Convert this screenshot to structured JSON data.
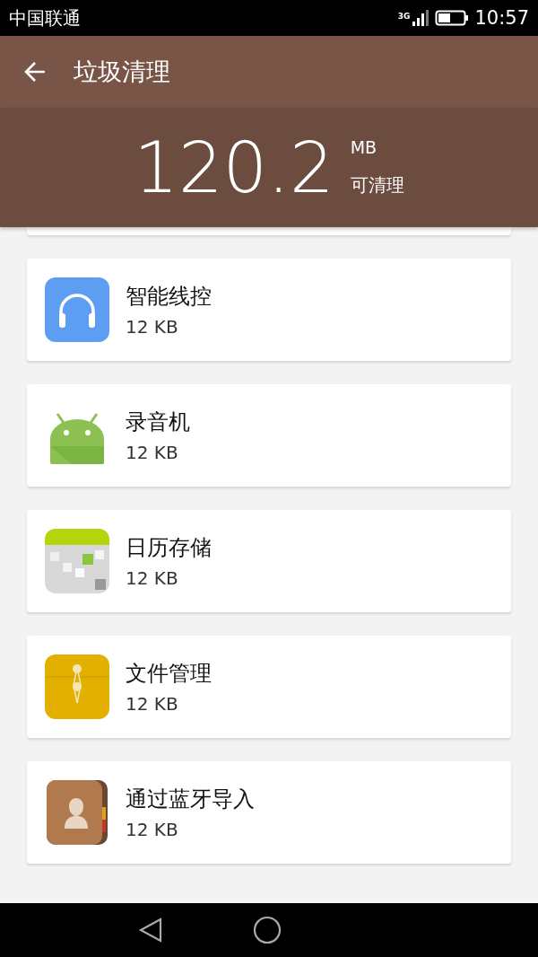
{
  "status_bar": {
    "carrier": "中国联通",
    "network": "3G",
    "time": "10:57"
  },
  "app_bar": {
    "title": "垃圾清理"
  },
  "summary": {
    "amount": "120.2",
    "unit": "MB",
    "caption": "可清理"
  },
  "items": [
    {
      "kind": "headphones",
      "name": "智能线控",
      "size": "12 KB"
    },
    {
      "kind": "android",
      "name": "录音机",
      "size": "12 KB"
    },
    {
      "kind": "calendar",
      "name": "日历存储",
      "size": "12 KB"
    },
    {
      "kind": "folder",
      "name": "文件管理",
      "size": "12 KB"
    },
    {
      "kind": "contacts",
      "name": "通过蓝牙导入",
      "size": "12 KB"
    }
  ]
}
